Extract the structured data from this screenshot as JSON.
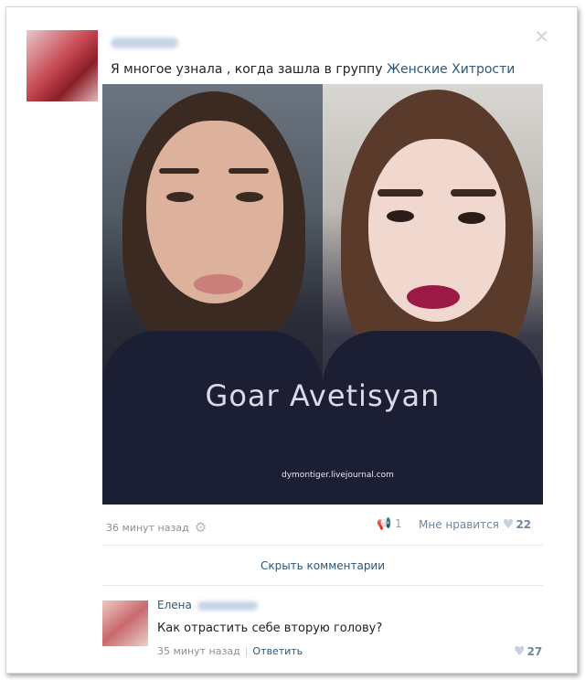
{
  "post": {
    "text_prefix": "Я многое узнала , когда зашла в группу ",
    "group_link": "Женские Хитрости",
    "image_watermark": "Goar Avetisyan",
    "image_credit": "dymontiger.livejournal.com",
    "time": "36 минут назад",
    "share_count": "1",
    "like_label": "Мне нравится",
    "like_count": "22"
  },
  "comments_toggle": "Скрыть комментарии",
  "comment": {
    "author_first": "Елена",
    "text": "Как отрастить себе вторую голову?",
    "time": "35 минут назад",
    "reply_label": "Ответить",
    "like_count": "27"
  },
  "icons": {
    "close": "close-icon",
    "settings": "gear-icon",
    "share": "megaphone-icon",
    "like": "heart-icon"
  },
  "colors": {
    "link": "#2b587a",
    "meta": "#8e8e8e",
    "like": "#6f86a0"
  }
}
